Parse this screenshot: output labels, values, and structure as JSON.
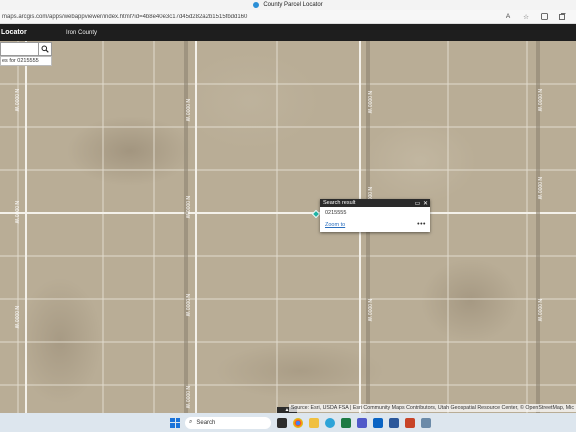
{
  "browser": {
    "tab_title": "County Parcel Locator",
    "url": "maps.arcgis.com/apps/webappviewer/index.html?id=4b8e40e3c17d45d282a2b1515fbdd160",
    "reader_icon": "A",
    "star_icon": "☆"
  },
  "app": {
    "name": "Locator",
    "county": "Iron County"
  },
  "search": {
    "value": "",
    "clear_label": "✕",
    "suggestion": "es for 0215555"
  },
  "map": {
    "road_label": "N 0000 W"
  },
  "popup": {
    "title": "Search result",
    "minimize": "▭",
    "close": "✕",
    "value": "0215555",
    "zoom_label": "Zoom to",
    "more_label": "•••"
  },
  "attribution": "Source: Esri, USDA FSA | Esri Community Maps Contributors, Utah Geospatial Resource Center, © OpenStreetMap, Mic",
  "collapse_label": "▲",
  "taskbar": {
    "search_label": "Search"
  },
  "colors": {
    "header": "#1e1e1e",
    "popup_header": "#2b2b2b",
    "link": "#2a6ebd",
    "marker": "#1fb5a5"
  }
}
